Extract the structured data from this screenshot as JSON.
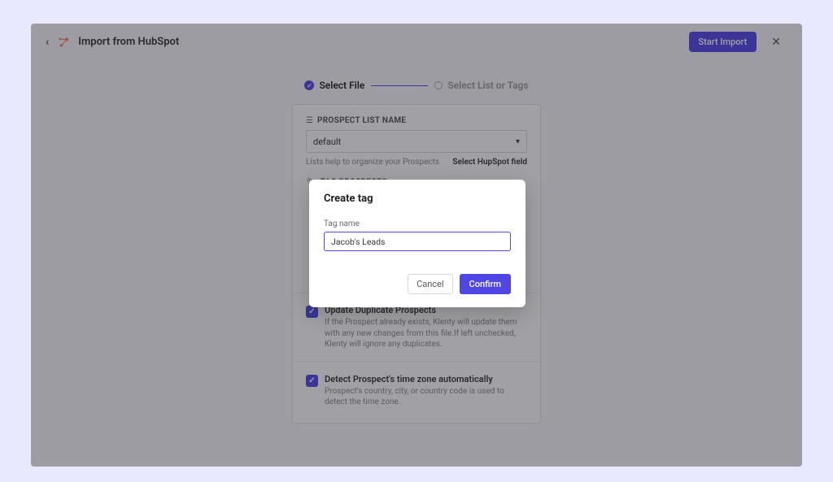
{
  "header": {
    "title": "Import from HubSpot",
    "start_import_label": "Start Import"
  },
  "stepper": {
    "step1_label": "Select File",
    "step2_label": "Select List or Tags"
  },
  "sections": {
    "prospect_list": {
      "label": "PROSPECT LIST NAME",
      "selected": "default",
      "helper": "Lists help to organize your Prospects",
      "link": "Select HupSpot field"
    },
    "tag_prospects": {
      "label": "TAG PROSPECTS"
    },
    "update_duplicate": {
      "title": "Update Duplicate Prospects",
      "desc": "If the Prospect already exists, Klenty will update them with any new changes from this file.If left unchecked, Klenty will ignore any duplicates."
    },
    "detect_tz": {
      "title": "Detect Prospect's time zone automatically",
      "desc": "Prospect's country, city, or country code is used to detect the time zone."
    }
  },
  "modal": {
    "title": "Create tag",
    "input_label": "Tag name",
    "input_value": "Jacob's Leads",
    "cancel_label": "Cancel",
    "confirm_label": "Confirm"
  }
}
